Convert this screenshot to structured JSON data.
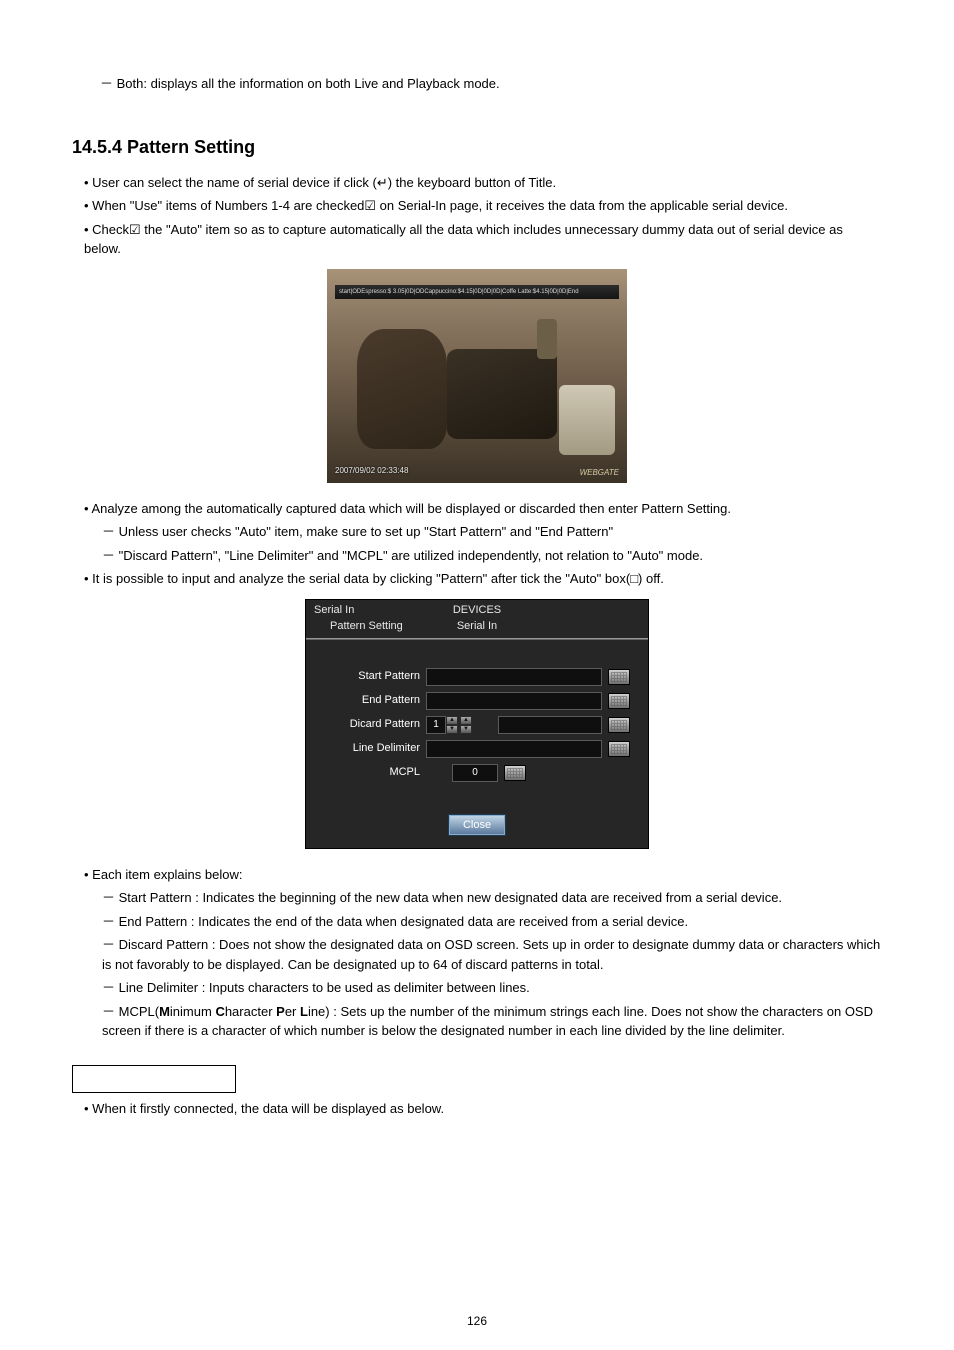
{
  "intro_dash": "Both: displays all the information on both Live and Playback mode.",
  "heading": "14.5.4  Pattern Setting",
  "bul1": "User can select the name of serial device if click (↵) the keyboard button of Title.",
  "bul2": "When \"Use\" items of Numbers 1-4 are checked☑ on Serial-In page, it receives the data from the applicable serial device.",
  "bul3": "Check☑ the \"Auto\" item so as to capture automatically all the data which includes unnecessary dummy data out of serial device as below.",
  "photo_overlay_bar": "start|ODEspresso:$ 3.05|0D|ODCappuccino:$4.15|0D|0D|0D|Coffe Latte:$4.15|0D|0D|End",
  "photo_timestamp": "2007/09/02   02:33:48",
  "photo_logo": "WEBGATE",
  "bul4": "Analyze among the automatically captured data which will be displayed or discarded then enter Pattern Setting.",
  "bul4a": "Unless user checks \"Auto\" item, make sure to set up \"Start Pattern\" and \"End Pattern\"",
  "bul4b": "\"Discard Pattern\", \"Line Delimiter\" and \"MCPL\" are utilized independently, not relation to \"Auto\" mode.",
  "bul5": "It is possible to input and analyze the serial data by clicking \"Pattern\" after tick the \"Auto\" box(□) off.",
  "dialog": {
    "tab_l1_left": "Serial In",
    "tab_l1_mid": "DEVICES",
    "tab_l2_left": "Pattern Setting",
    "tab_l2_mid": "Serial In",
    "rows": {
      "start": "Start Pattern",
      "end": "End Pattern",
      "discard": "Dicard Pattern",
      "discard_spin": "1",
      "line": "Line Delimiter",
      "mcpl": "MCPL",
      "mcpl_val": "0"
    },
    "close": "Close"
  },
  "bul6": "Each item explains below:",
  "bul6a": "Start Pattern : Indicates the beginning of the new data when new designated data are received from a serial device.",
  "bul6b": "End Pattern : Indicates the end of the data when designated data are received from a serial device.",
  "bul6c": "Discard Pattern : Does not show the designated data on OSD screen. Sets up in order to designate dummy data or characters which is not favorably to be displayed. Can be designated up to 64 of discard patterns in total.",
  "bul6d": "Line Delimiter : Inputs characters to be used as delimiter between lines.",
  "bul6e_prefix": "MCPL(",
  "bul6e_b1": "M",
  "bul6e_t1": "inimum ",
  "bul6e_b2": "C",
  "bul6e_t2": "haracter ",
  "bul6e_b3": "P",
  "bul6e_t3": "er ",
  "bul6e_b4": "L",
  "bul6e_t4": "ine) : Sets up the number of the minimum strings each line. Does not show the characters on OSD screen if there is a character of which number is below the designated number in each line divided by the line delimiter.",
  "bul7": "When it firstly connected, the data will be displayed as below.",
  "page_num": "126"
}
